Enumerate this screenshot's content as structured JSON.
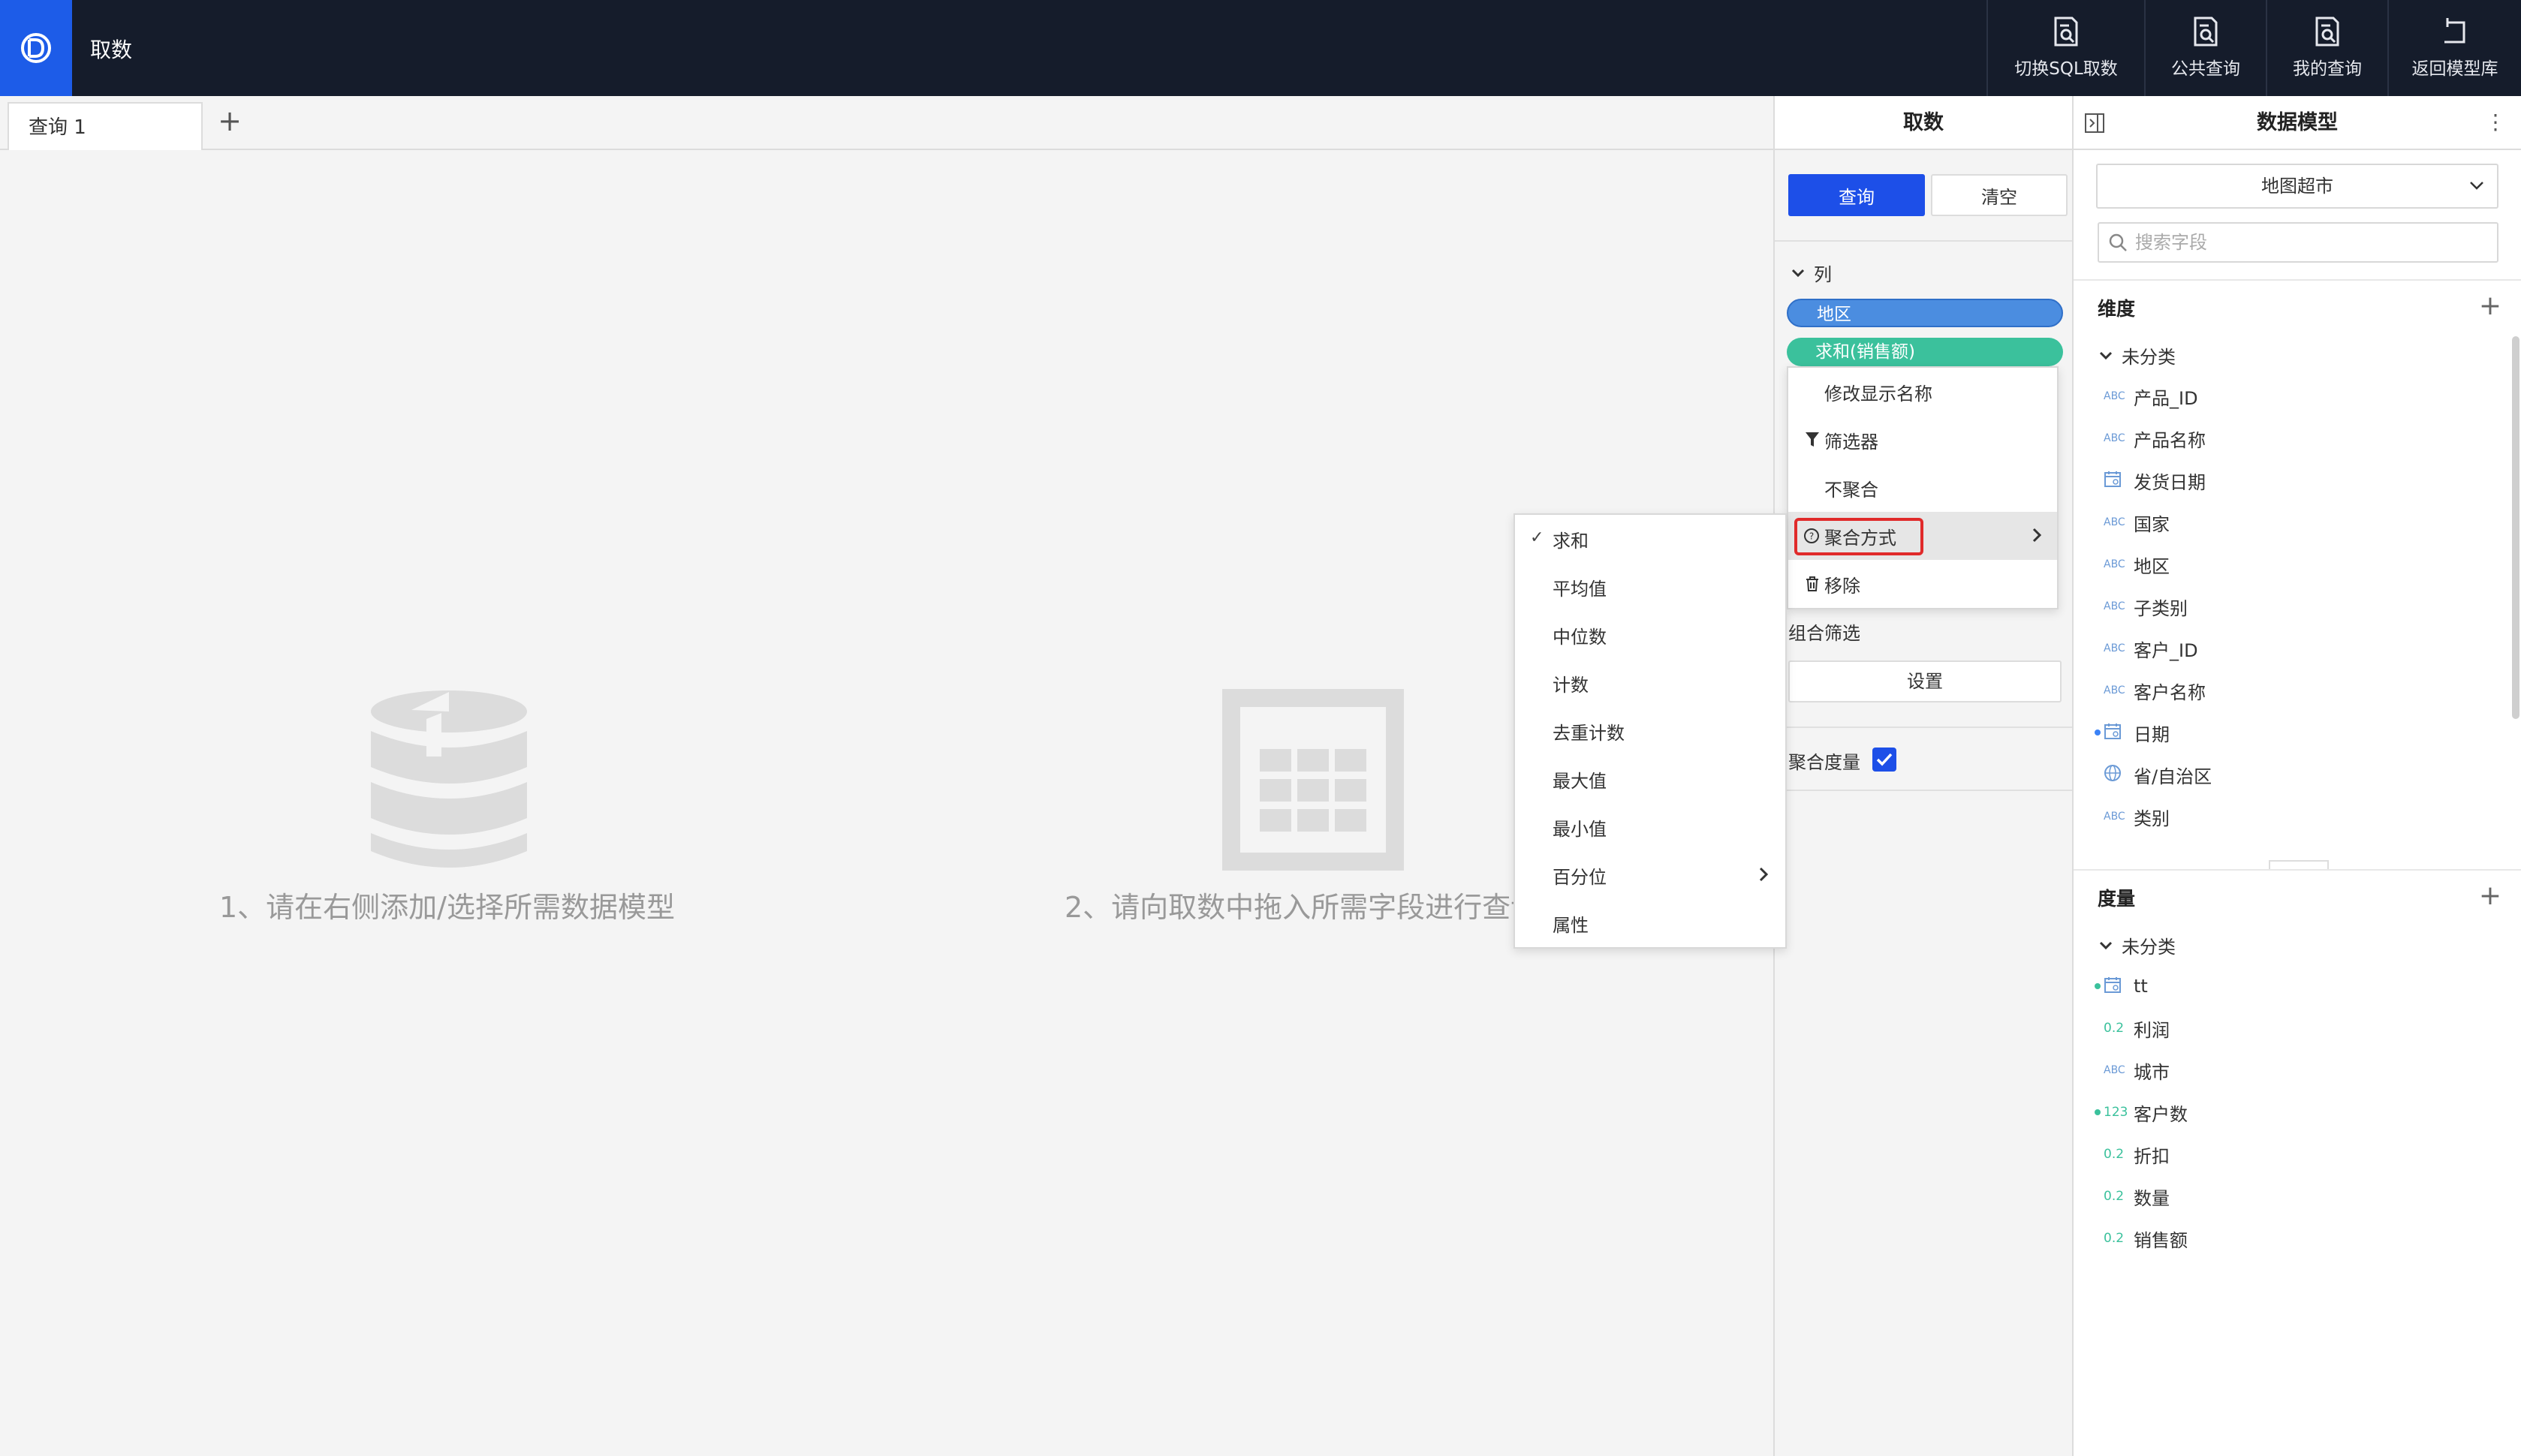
{
  "app": {
    "title": "取数"
  },
  "top_actions": [
    {
      "label": "切换SQL取数"
    },
    {
      "label": "公共查询"
    },
    {
      "label": "我的查询"
    },
    {
      "label": "返回模型库"
    }
  ],
  "tabs": [
    {
      "label": "查询 1"
    }
  ],
  "tab_add": "+",
  "canvas": {
    "hint1": "1、请在右侧添加/选择所需数据模型",
    "hint2": "2、请向取数中拖入所需字段进行查询"
  },
  "fetch_panel": {
    "title": "取数",
    "query_button": "查询",
    "clear_button": "清空",
    "columns_label": "列",
    "pills": [
      {
        "label": "地区"
      },
      {
        "label": "求和(销售额)"
      }
    ],
    "combo_filter_label": "组合筛选",
    "setting_button": "设置",
    "aggregate_measure_label": "聚合度量"
  },
  "context_menu": {
    "items": [
      {
        "label": "修改显示名称",
        "icon": "none"
      },
      {
        "label": "筛选器",
        "icon": "filter-icon"
      },
      {
        "label": "不聚合",
        "icon": "none"
      },
      {
        "label": "聚合方式",
        "icon": "question-circle-icon",
        "active": true,
        "highlighted": true
      },
      {
        "label": "移除",
        "icon": "trash-icon"
      }
    ]
  },
  "aggregation_submenu": {
    "items": [
      {
        "label": "求和",
        "checked": true
      },
      {
        "label": "平均值"
      },
      {
        "label": "中位数"
      },
      {
        "label": "计数"
      },
      {
        "label": "去重计数"
      },
      {
        "label": "最大值"
      },
      {
        "label": "最小值"
      },
      {
        "label": "百分位",
        "has_submenu": true
      },
      {
        "label": "属性"
      }
    ]
  },
  "model_panel": {
    "title": "数据模型",
    "selected_model": "地图超市",
    "search_placeholder": "搜索字段",
    "dimensions": {
      "title": "维度",
      "group": "未分类",
      "fields": [
        {
          "name": "产品_ID",
          "type": "ABC"
        },
        {
          "name": "产品名称",
          "type": "ABC"
        },
        {
          "name": "发货日期",
          "type": "date"
        },
        {
          "name": "国家",
          "type": "ABC"
        },
        {
          "name": "地区",
          "type": "ABC"
        },
        {
          "name": "子类别",
          "type": "ABC"
        },
        {
          "name": "客户_ID",
          "type": "ABC"
        },
        {
          "name": "客户名称",
          "type": "ABC"
        },
        {
          "name": "日期",
          "type": "date",
          "dot": "#3b82f6"
        },
        {
          "name": "省/自治区",
          "type": "geo"
        },
        {
          "name": "类别",
          "type": "ABC"
        }
      ]
    },
    "measures": {
      "title": "度量",
      "group": "未分类",
      "fields": [
        {
          "name": "tt",
          "type": "date",
          "dot": "#3bc19c"
        },
        {
          "name": "利润",
          "type": "0.2"
        },
        {
          "name": "城市",
          "type": "ABC"
        },
        {
          "name": "客户数",
          "type": "123",
          "dot": "#3bc19c"
        },
        {
          "name": "折扣",
          "type": "0.2"
        },
        {
          "name": "数量",
          "type": "0.2"
        },
        {
          "name": "销售额",
          "type": "0.2"
        }
      ]
    }
  },
  "colors": {
    "topbar": "#151c2b",
    "logo": "#1d5ce8",
    "primary": "#1d4fe8",
    "pill_blue": "#4b8de0",
    "pill_green": "#3bc19c",
    "highlight_red": "#e02a2a"
  }
}
